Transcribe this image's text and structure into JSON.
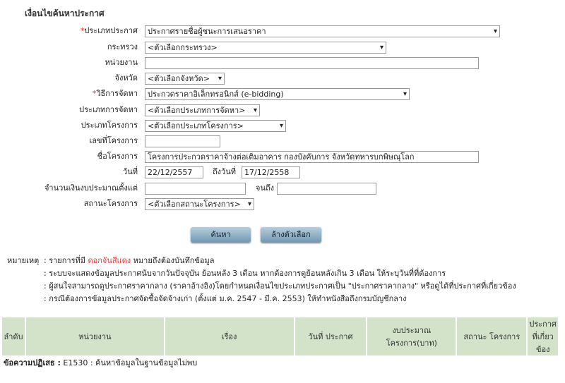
{
  "section_title": "เงื่อนไขค้นหาประกาศ",
  "form": {
    "announce_type": {
      "label": "ประเภทประกาศ",
      "value": "ประกาศรายชื่อผู้ชนะการเสนอราคา"
    },
    "ministry": {
      "label": "กระทรวง",
      "value": "<ตัวเลือกกระทรวง>"
    },
    "agency": {
      "label": "หน่วยงาน",
      "value": ""
    },
    "province": {
      "label": "จังหวัด",
      "value": "<ตัวเลือกจังหวัด>"
    },
    "method": {
      "label": "วิธีการจัดหา",
      "value": "ประกวดราคาอิเล็กทรอนิกส์ (e-bidding)"
    },
    "procure_type": {
      "label": "ประเภทการจัดหา",
      "value": "<ตัวเลือกประเภทการจัดหา>"
    },
    "project_type": {
      "label": "ประเภทโครงการ",
      "value": "<ตัวเลือกประเภทโครงการ>"
    },
    "project_no": {
      "label": "เลขที่โครงการ",
      "value": ""
    },
    "project_name": {
      "label": "ชื่อโครงการ",
      "value": "โครงการประกวดราคาจ้างต่อเติมอาคาร กองบังคับการ จังหวัดทหารบกพิษณุโลก"
    },
    "date_from": {
      "label": "วันที่",
      "value": "22/12/2557"
    },
    "date_to": {
      "label": "ถึงวันที่",
      "value": "17/12/2558"
    },
    "budget_from": {
      "label": "จำนวนเงินงบประมาณตั้งแต่",
      "value": ""
    },
    "budget_to": {
      "label": "จนถึง",
      "value": ""
    },
    "status": {
      "label": "สถานะโครงการ",
      "value": "<ตัวเลือกสถานะโครงการ>"
    },
    "required_mark": "*"
  },
  "buttons": {
    "search": "ค้นหา",
    "clear": "ล้างตัวเลือก"
  },
  "notes": {
    "label": "หมายเหตุ",
    "line1_pre": ": รายการที่มี ",
    "line1_red": "ดอกจันสีแดง",
    "line1_post": " หมายถึงต้องบันทึกข้อมูล",
    "line2": ": ระบบจะแสดงข้อมูลประกาศนับจากวันปัจจุบัน ย้อนหลัง 3 เดือน หากต้องการดูย้อนหลังเกิน 3 เดือน ให้ระบุวันที่ที่ต้องการ",
    "line3": ": ผู้สนใจสามารถดูประกาศราคากลาง (ราคาอ้างอิง)โดยกำหนดเงื่อนไขประเภทประกาศเป็น \"ประกาศราคากลาง\" หรือดูได้ที่ประกาศที่เกี่ยวข้อง",
    "line4": ": กรณีต้องการข้อมูลประกาศจัดซื้อจัดจ้างเก่า (ตั้งแต่ ม.ค. 2547 - มี.ค. 2553) ให้ทำหนังสือถึงกรมบัญชีกลาง"
  },
  "table": {
    "columns": [
      "ลำดับ",
      "หน่วยงาน",
      "เรื่อง",
      "วันที่ ประกาศ",
      "งบประมาณ โครงการ(บาท)",
      "สถานะ โครงการ",
      "ประกาศ ที่เกี่ยว ข้อง"
    ]
  },
  "error": {
    "label": "ข้อความปฏิเสธ :",
    "message": " E1530 : ค้นหาข้อมูลในฐานข้อมูลไม่พบ"
  },
  "colors": {
    "table_header": "#d2e3c9",
    "required": "#e33333",
    "button": "#8fb0c6"
  }
}
